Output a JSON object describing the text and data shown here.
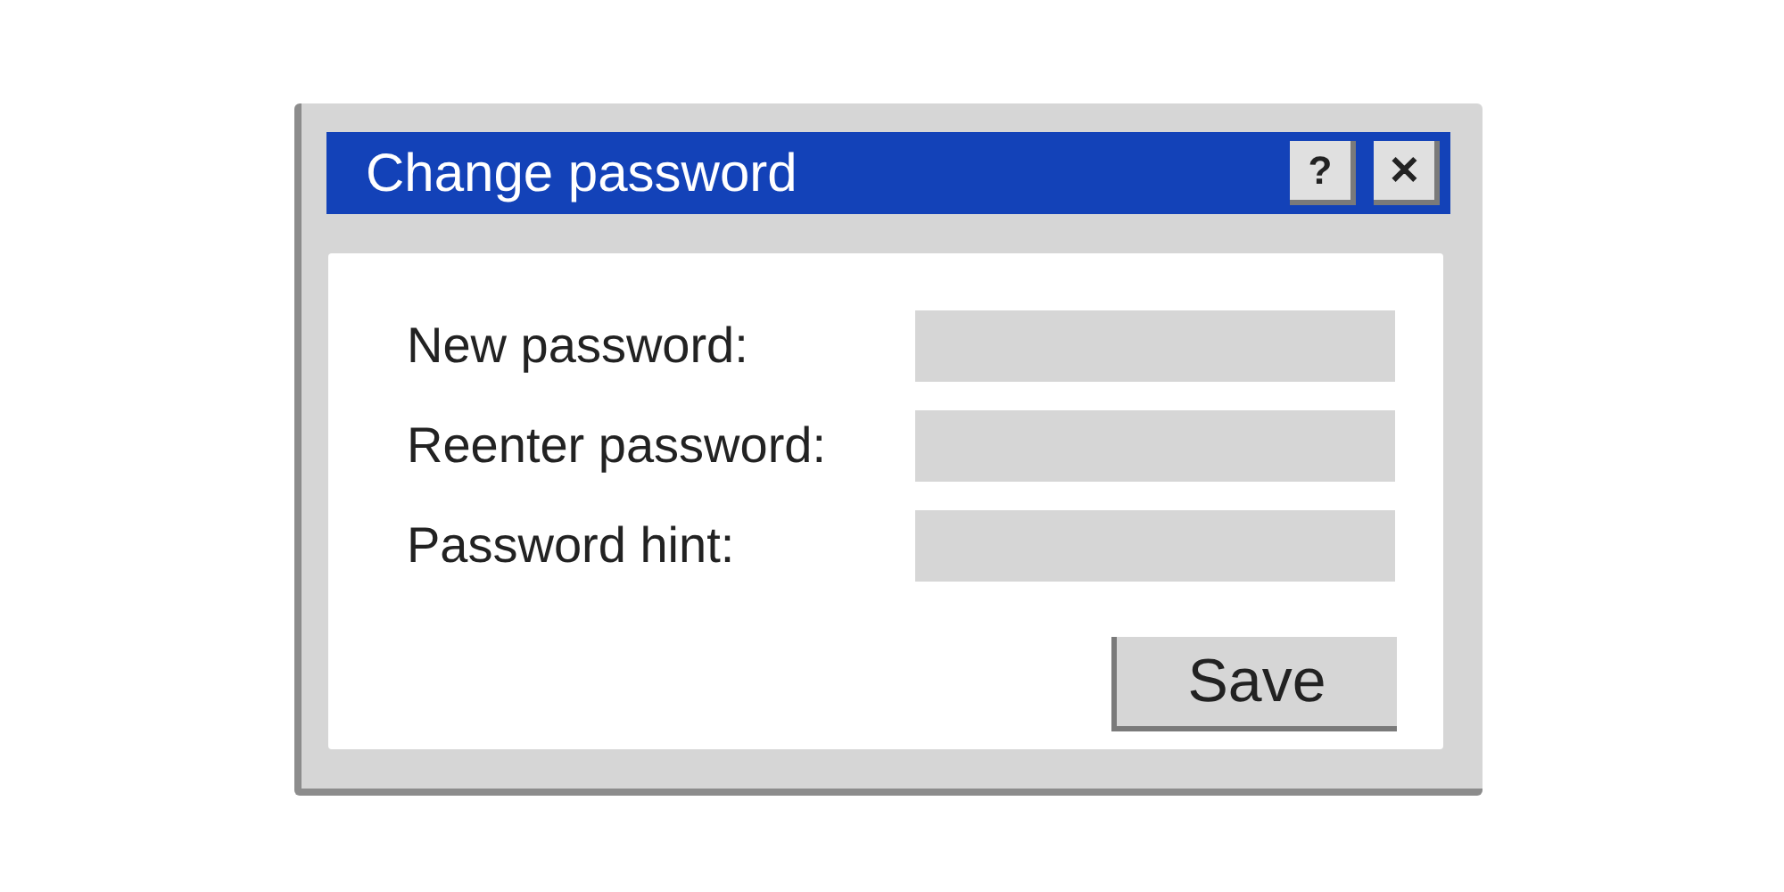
{
  "window": {
    "title": "Change password",
    "buttons": [
      "?",
      "✕"
    ]
  },
  "fields": [
    {
      "label": "New password:"
    },
    {
      "label": "Reenter password:"
    },
    {
      "label": "Password hint:"
    }
  ],
  "buttons": [
    "Save"
  ]
}
